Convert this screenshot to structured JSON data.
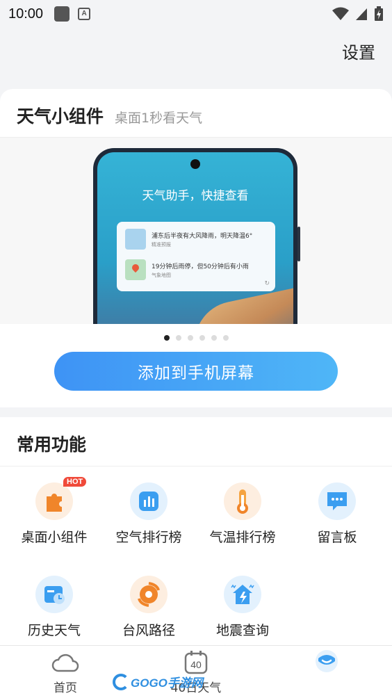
{
  "status_bar": {
    "time": "10:00",
    "icons": [
      "square-notification-icon",
      "a-notification-icon",
      "wifi-icon",
      "signal-icon",
      "battery-charging-icon"
    ]
  },
  "header": {
    "settings_label": "设置"
  },
  "widget": {
    "title": "天气小组件",
    "subtitle": "桌面1秒看天气",
    "preview": {
      "headline": "天气助手，快捷查看",
      "row1_text": "浦东后半夜有大风降雨，明天降温6°",
      "row1_sub": "精准预报",
      "row2_text": "19分钟后雨停，但50分钟后有小雨",
      "row2_sub": "气象地图"
    },
    "dots_count": 6,
    "active_dot": 0,
    "add_button_label": "添加到手机屏幕"
  },
  "functions": {
    "title": "常用功能",
    "items": [
      {
        "label": "桌面小组件",
        "icon": "puzzle-icon",
        "badge": "HOT"
      },
      {
        "label": "空气排行榜",
        "icon": "air-bars-icon"
      },
      {
        "label": "气温排行榜",
        "icon": "thermometer-icon"
      },
      {
        "label": "留言板",
        "icon": "message-icon"
      },
      {
        "label": "历史天气",
        "icon": "history-calendar-icon"
      },
      {
        "label": "台风路径",
        "icon": "typhoon-icon"
      },
      {
        "label": "地震查询",
        "icon": "earthquake-icon"
      }
    ]
  },
  "bottom_nav": {
    "items": [
      {
        "label": "首页",
        "icon": "cloud-icon"
      },
      {
        "label": "40日天气",
        "icon": "calendar-40-icon",
        "icon_text": "40"
      },
      {
        "label": "",
        "icon": "mine-icon"
      }
    ],
    "active_index": 2
  },
  "watermark": {
    "text": "GOGO手游网",
    "logo_letter": "GO"
  },
  "colors": {
    "accent": "#3e93f5",
    "hot": "#f04a3a",
    "orange": "#f08a2a",
    "blue_icon": "#3b9ef0"
  }
}
